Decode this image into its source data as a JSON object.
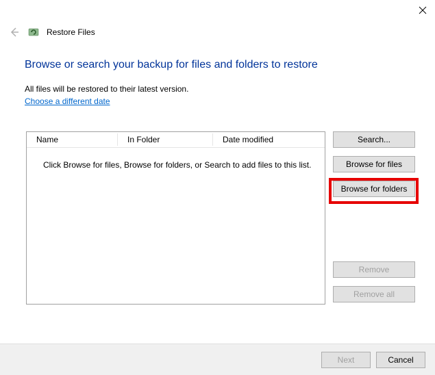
{
  "window": {
    "title": "Restore Files",
    "heading": "Browse or search your backup for files and folders to restore",
    "subtext": "All files will be restored to their latest version.",
    "date_link": "Choose a different date"
  },
  "list": {
    "columns": {
      "name": "Name",
      "folder": "In Folder",
      "date": "Date modified"
    },
    "empty_text": "Click Browse for files, Browse for folders, or Search to add files to this list."
  },
  "buttons": {
    "search": "Search...",
    "browse_files": "Browse for files",
    "browse_folders": "Browse for folders",
    "remove": "Remove",
    "remove_all": "Remove all"
  },
  "footer": {
    "next": "Next",
    "cancel": "Cancel"
  }
}
